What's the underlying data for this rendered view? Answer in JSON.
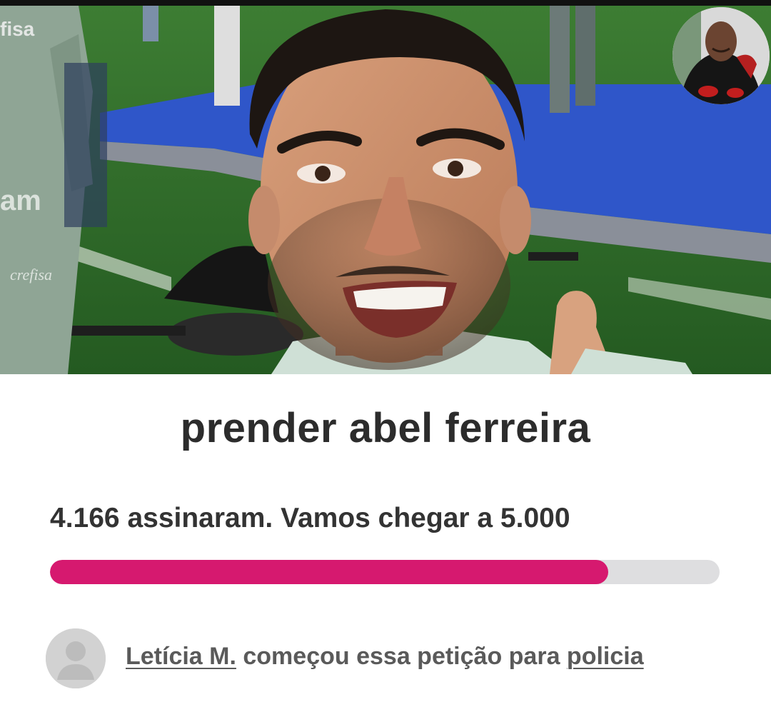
{
  "petition": {
    "title": "prender abel ferreira",
    "signed_count": "4.166",
    "signed_label": "assinaram. Vamos chegar a ",
    "goal": "5.000",
    "progress_fraction": 0.8332
  },
  "starter": {
    "name": "Letícia M.",
    "action_text": " começou essa petição para ",
    "target": "policia"
  },
  "hero": {
    "jersey_texts": [
      "fisa",
      "am",
      "crefisa"
    ]
  },
  "colors": {
    "progress_fill": "#d6196f",
    "progress_track": "#dedee0",
    "title_text": "#2c2c2c",
    "body_text": "#333333",
    "starter_text": "#5a5a5a",
    "field_green": "#2f6b2a",
    "stage_blue": "#2f56c9"
  },
  "icons": {
    "starter_avatar": "user-placeholder-icon",
    "corner_badge": "profile-avatar-icon"
  }
}
